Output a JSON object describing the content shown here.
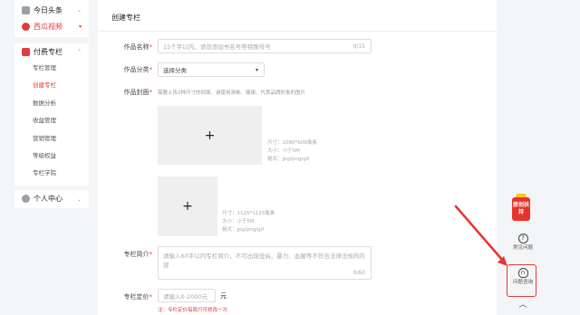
{
  "sidebar": {
    "top_items": [
      {
        "label": "今日头条"
      },
      {
        "label": "西瓜视频"
      }
    ],
    "section": {
      "label": "付费专栏"
    },
    "sub_items": [
      {
        "label": "专栏管理"
      },
      {
        "label": "创建专栏"
      },
      {
        "label": "数据分析"
      },
      {
        "label": "收益管理"
      },
      {
        "label": "营销管理"
      },
      {
        "label": "等级权益"
      },
      {
        "label": "专栏学院"
      }
    ],
    "user": {
      "label": "个人中心"
    }
  },
  "page": {
    "title": "创建专栏"
  },
  "form": {
    "name_label": "作品名称",
    "name_placeholder": "15个字以内，请勿添加书名号等特殊符号",
    "name_counter": "0/15",
    "category_label": "作品分类",
    "category_value": "选择分类",
    "cover_label": "作品封面",
    "cover_hint": "需要上传2种尺寸的封面，请使用清晰、健康、代表品牌形象的图片",
    "cover1_spec": [
      "尺寸：1080*608像素",
      "大小：小于5M",
      "格式：jpg/png/gif"
    ],
    "cover2_spec": [
      "尺寸：1125*1125像素",
      "大小：小于5M",
      "格式：jpg/png/gif"
    ],
    "intro_label": "专栏简介",
    "intro_placeholder": "请输入60字以内专栏简介，不可出现低俗、暴力、血腥等不符合法律法规的内容",
    "intro_counter": "0/60",
    "price_label": "专栏定价",
    "price_placeholder": "请输入0-2000元",
    "price_unit": "元",
    "price_warning": "注：专栏定价每周只可修改一次"
  },
  "rightbar": {
    "badge_text": "原创扶持",
    "faq_label": "常见问题",
    "support_label": "问题咨询"
  },
  "colors": {
    "accent": "#e13b3b",
    "badge": "#e8332b"
  }
}
